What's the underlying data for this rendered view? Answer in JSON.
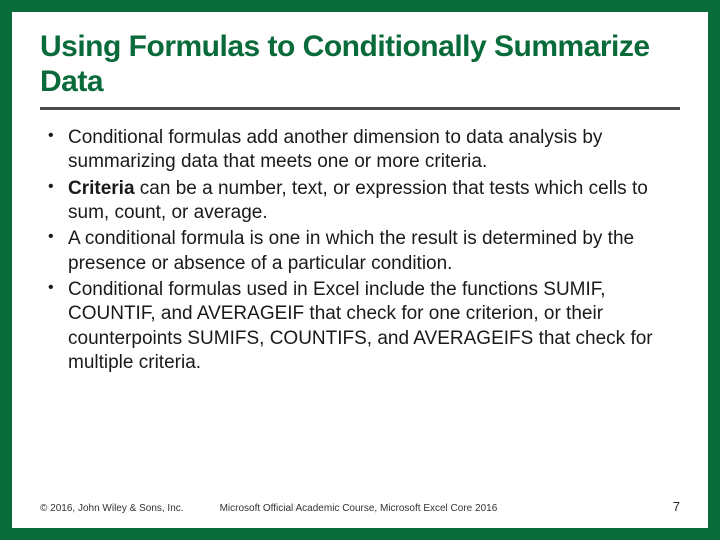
{
  "title": "Using Formulas to Conditionally Summarize Data",
  "bullets": [
    {
      "pre": "",
      "bold": "",
      "post": "Conditional formulas add another dimension to data analysis by summarizing data that meets one or more criteria."
    },
    {
      "pre": "",
      "bold": "Criteria",
      "post": " can be a number, text, or expression that tests which cells to sum, count, or average."
    },
    {
      "pre": "",
      "bold": "",
      "post": "A conditional formula is one in which the result is determined by the presence or absence of a particular condition."
    },
    {
      "pre": "",
      "bold": "",
      "post": "Conditional formulas used in Excel include the functions SUMIF, COUNTIF, and AVERAGEIF that check for one criterion, or their counterpoints SUMIFS, COUNTIFS, and AVERAGEIFS that check for multiple criteria."
    }
  ],
  "footer": {
    "copyright": "© 2016, John Wiley & Sons, Inc.",
    "course": "Microsoft Official Academic Course, Microsoft Excel Core 2016",
    "page": "7"
  }
}
